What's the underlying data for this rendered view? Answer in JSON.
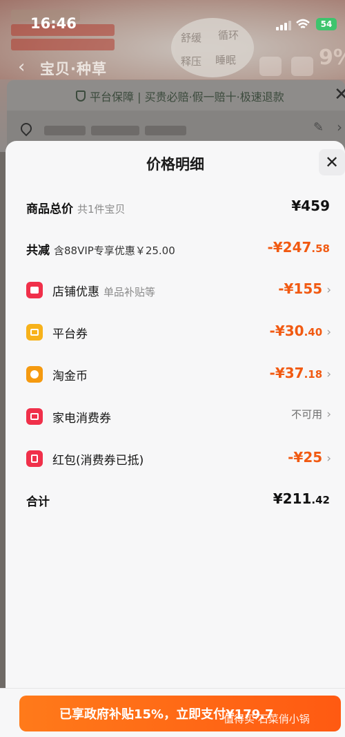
{
  "status_bar": {
    "time": "16:46",
    "battery": "54"
  },
  "background": {
    "nav_title": "宝贝·种草",
    "bg_promo": "9%",
    "disc_labels": [
      "舒缓",
      "循环",
      "释压",
      "睡眠"
    ],
    "guarantee_text": "平台保障 | 买贵必赔·假一赔十·极速退款"
  },
  "sheet": {
    "title": "价格明细",
    "close": "✕",
    "rows": [
      {
        "label": "商品总价",
        "sub": "共1件宝贝",
        "amount_main": "¥459",
        "amount_dec": ""
      },
      {
        "label": "共减",
        "sub": "含88VIP专享优惠￥25.00",
        "amount_main": "-¥247",
        "amount_dec": ".58"
      },
      {
        "label": "店铺优惠",
        "sub": "单品补贴等",
        "amount_main": "-¥155",
        "amount_dec": ""
      },
      {
        "label": "平台券",
        "sub": "",
        "amount_main": "-¥30",
        "amount_dec": ".40"
      },
      {
        "label": "淘金币",
        "sub": "",
        "amount_main": "-¥37",
        "amount_dec": ".18"
      },
      {
        "label": "家电消费券",
        "sub": "",
        "amount_main": "不可用",
        "amount_dec": ""
      },
      {
        "label": "红包(消费券已抵)",
        "sub": "",
        "amount_main": "-¥25",
        "amount_dec": ""
      },
      {
        "label": "合计",
        "sub": "",
        "amount_main": "¥211",
        "amount_dec": ".42"
      }
    ],
    "chevron": "›"
  },
  "bottom": {
    "pay_label": "已享政府补贴15%，立即支付¥179.7",
    "watermark": "值得买·石菜俏小锅"
  },
  "colors": {
    "accent_orange": "#f15a12",
    "shop_icon": "#f0304a",
    "platform_icon": "#f7b21b",
    "coin_icon": "#f59a10",
    "voucher_icon": "#f0304a",
    "packet_icon": "#f0304a"
  }
}
